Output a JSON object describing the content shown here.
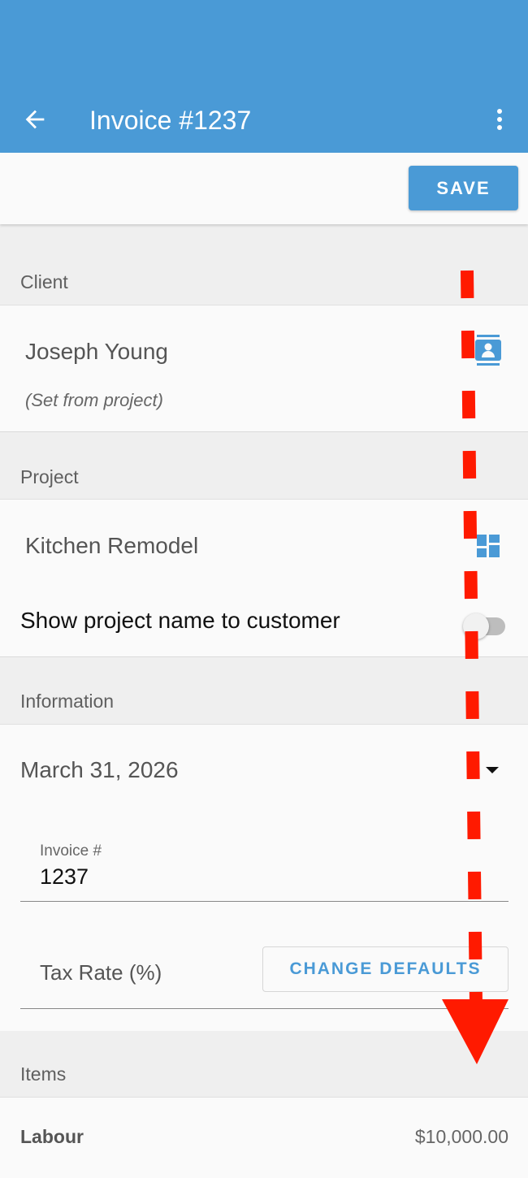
{
  "app_bar": {
    "title": "Invoice #1237",
    "back_icon": "arrow-back-icon",
    "menu_icon": "more-vert-icon",
    "color": "#4a9ad6"
  },
  "toolbar": {
    "save_label": "SAVE"
  },
  "sections": {
    "client": "Client",
    "project": "Project",
    "information": "Information",
    "items": "Items"
  },
  "client": {
    "name": "Joseph Young",
    "note": "(Set from project)",
    "icon": "contact-card-icon"
  },
  "project": {
    "name": "Kitchen Remodel",
    "icon": "dashboard-icon",
    "toggle_label": "Show project name to customer",
    "toggle_on": false
  },
  "information": {
    "date": "March 31, 2026",
    "invoice_label": "Invoice #",
    "invoice_value": "1237",
    "tax_label": "Tax Rate (%)",
    "change_defaults_label": "CHANGE DEFAULTS"
  },
  "items": [
    {
      "name": "Labour",
      "amount": "$10,000.00"
    }
  ],
  "overlay": {
    "arrow_color": "#ff1a00",
    "icon": "scroll-down-arrow-icon"
  }
}
